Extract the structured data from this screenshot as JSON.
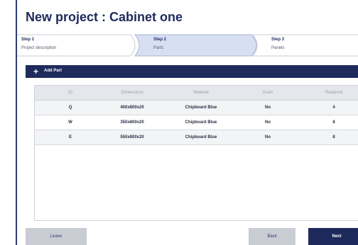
{
  "page": {
    "title": "New project : Cabinet one"
  },
  "stepper": {
    "steps": [
      {
        "number": "Step 1",
        "label": "Project description",
        "active": false
      },
      {
        "number": "Step 2",
        "label": "Parts",
        "active": true
      },
      {
        "number": "Step 3",
        "label": "Panels",
        "active": false
      }
    ]
  },
  "toolbar": {
    "add_part_label": "Add Part",
    "add_icon": "plus-icon"
  },
  "table": {
    "columns": [
      "ID",
      "Dimensions",
      "Material",
      "Grain",
      "Required"
    ],
    "rows": [
      [
        "Q",
        "400x800x20",
        "Chipboard Blue",
        "No",
        "4"
      ],
      [
        "W",
        "350x800x20",
        "Chipboard Blue",
        "No",
        "8"
      ],
      [
        "E",
        "550x800x20",
        "Chipboard Blue",
        "No",
        "8"
      ]
    ]
  },
  "footer": {
    "leave_label": "Leave",
    "back_label": "Back",
    "next_label": "Next"
  },
  "colors": {
    "primary": "#1f2a5c",
    "active_step": "#d7e0f3",
    "secondary_button": "#c9ccd3"
  }
}
